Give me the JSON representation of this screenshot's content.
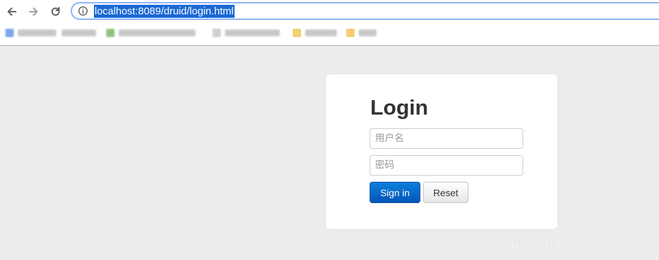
{
  "browser": {
    "url": "localhost:8089/druid/login.html",
    "icons": {
      "back": "arrow-left-icon",
      "forward": "arrow-right-icon",
      "reload": "reload-icon",
      "site_info": "info-icon"
    },
    "colors": {
      "url_highlight": "#1a68d6",
      "omnibox_focus": "#8ab4f8"
    }
  },
  "login": {
    "title": "Login",
    "username_placeholder": "用户名",
    "password_placeholder": "密码",
    "signin_label": "Sign in",
    "reset_label": "Reset"
  },
  "colors": {
    "page_background": "#ececec",
    "signin_button": "#0466c8",
    "card_background": "#ffffff"
  },
  "watermark": "https://blog.csdn.net/yangshangwei"
}
